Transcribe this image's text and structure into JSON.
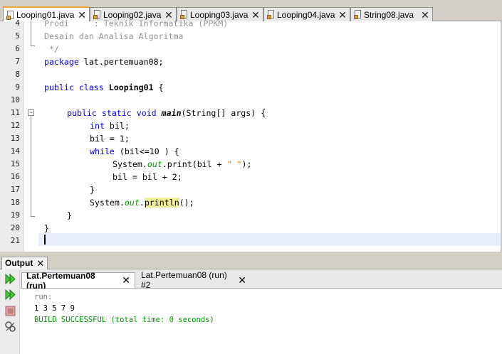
{
  "editor_tabs": [
    {
      "label": "Looping01.java",
      "active": true
    },
    {
      "label": "Looping02.java",
      "active": false
    },
    {
      "label": "Looping03.java",
      "active": false
    },
    {
      "label": "Looping04.java",
      "active": false
    },
    {
      "label": "String08.java",
      "active": false
    }
  ],
  "close_glyph": "✕",
  "editor": {
    "line_numbers": [
      "4",
      "5",
      "6",
      "7",
      "8",
      "9",
      "10",
      "11",
      "12",
      "13",
      "14",
      "15",
      "16",
      "17",
      "18",
      "19",
      "20",
      "21"
    ],
    "code": {
      "l4": "Prodi     : Teknik Informatika (PPKM)",
      "l5": "Desain dan Analisa Algoritma",
      "l6": " */",
      "l7_kw": "package",
      "l7_rest": " lat.pertemuan08;",
      "l9_kw": "public class",
      "l9_name": "Looping01",
      "l9_rest": " {",
      "l11_kw": "public static void",
      "l11_method": "main",
      "l11_rest": "(String[] args) {",
      "l12_kw": "int",
      "l12_rest": " bil;",
      "l13": "bil = 1;",
      "l14_kw": "while",
      "l14_rest": " (bil<=10 ) {",
      "l15_a": "System.",
      "l15_field": "out",
      "l15_b": ".print(bil + ",
      "l15_str": "\" \"",
      "l15_c": ");",
      "l16": "bil = bil + 2;",
      "l17": "}",
      "l18_a": "System.",
      "l18_field": "out",
      "l18_dot": ".",
      "l18_method": "println",
      "l18_c": "();",
      "l19": "}",
      "l20": "}"
    }
  },
  "output": {
    "panel_title": "Output",
    "tabs": [
      {
        "label": "Lat.Pertemuan08 (run)",
        "active": true
      },
      {
        "label": "Lat.Pertemuan08 (run) #2",
        "active": false
      }
    ],
    "lines": {
      "run": "run:",
      "result": "1 3 5 7 9",
      "build": "BUILD SUCCESSFUL (total time: 0 seconds)"
    }
  },
  "colors": {
    "keyword": "#0000e6",
    "comment": "#969696",
    "field": "#009900",
    "string": "#ce7b00",
    "highlight": "#eeee99",
    "build_success": "#009900"
  },
  "icons": [
    "java-file-icon",
    "close-icon",
    "fold-icon",
    "rerun-icon",
    "stop-icon",
    "settings-icon"
  ]
}
